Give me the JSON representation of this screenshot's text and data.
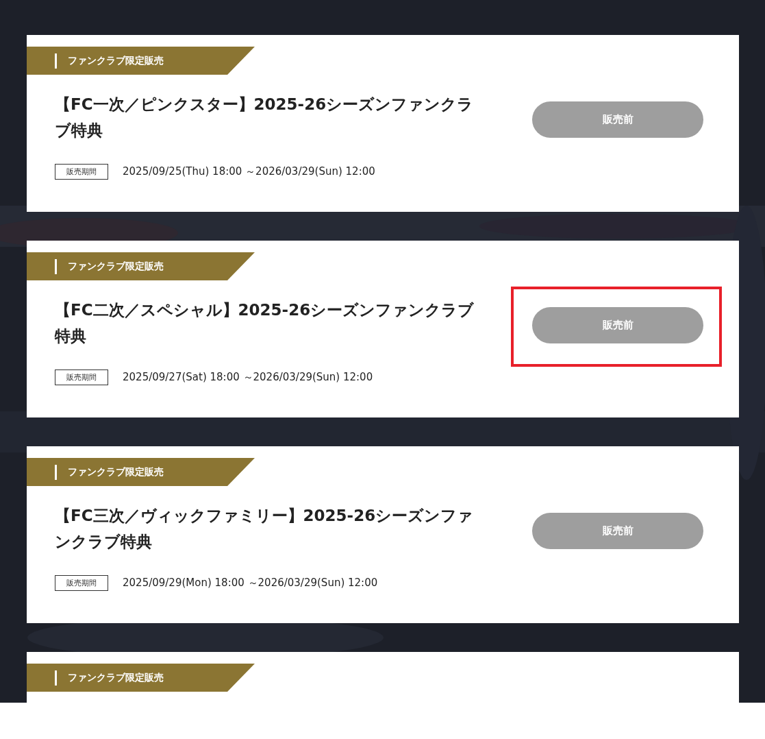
{
  "items": [
    {
      "banner": "ファンクラブ限定販売",
      "title": "【FC一次／ピンクスター】2025-26シーズンファンクラブ特典",
      "period_label": "販売期間",
      "period": "2025/09/25(Thu) 18:00 ～2026/03/29(Sun) 12:00",
      "button": {
        "label": "販売前",
        "disabled": true
      },
      "highlighted": false
    },
    {
      "banner": "ファンクラブ限定販売",
      "title": "【FC二次／スペシャル】2025-26シーズンファンクラブ特典",
      "period_label": "販売期間",
      "period": "2025/09/27(Sat) 18:00 ～2026/03/29(Sun) 12:00",
      "button": {
        "label": "販売前",
        "disabled": true
      },
      "highlighted": true
    },
    {
      "banner": "ファンクラブ限定販売",
      "title": "【FC三次／ヴィックファミリー】2025-26シーズンファンクラブ特典",
      "period_label": "販売期間",
      "period": "2025/09/29(Mon) 18:00 ～2026/03/29(Sun) 12:00",
      "button": {
        "label": "販売前",
        "disabled": true
      },
      "highlighted": false
    },
    {
      "banner": "ファンクラブ限定販売"
    }
  ]
}
